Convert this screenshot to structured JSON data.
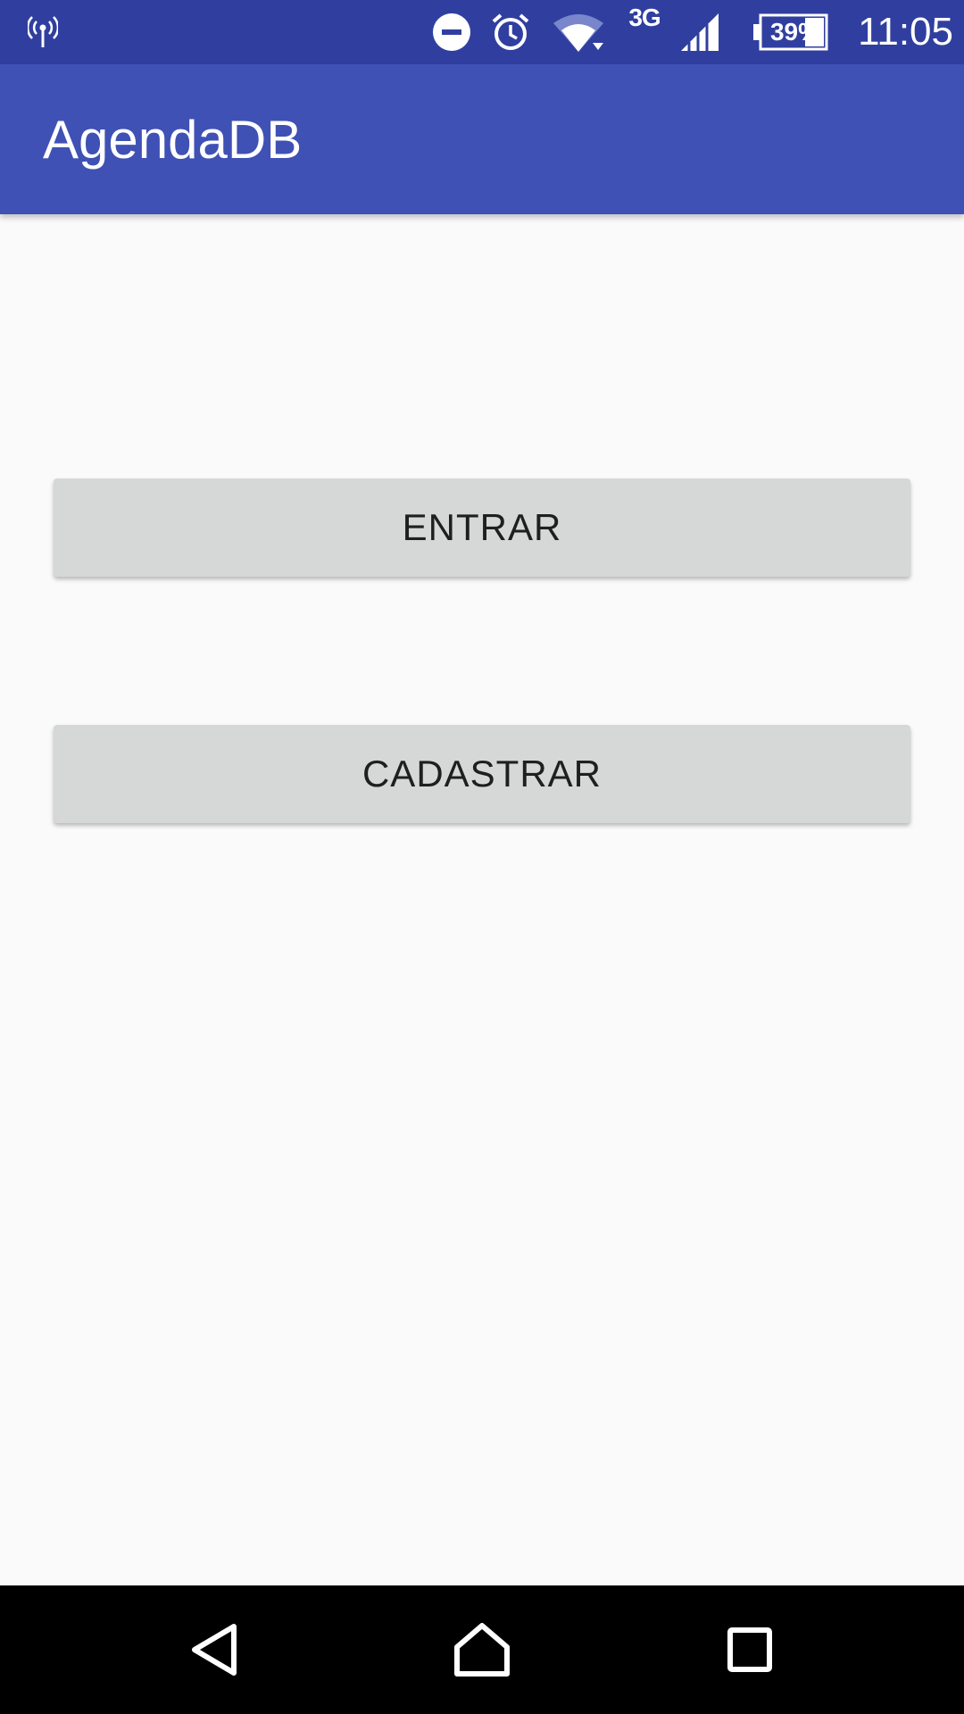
{
  "status_bar": {
    "network_type": "3G",
    "battery_percent": "39%",
    "time": "11:05",
    "icons": [
      "antenna-icon",
      "do-not-disturb-icon",
      "alarm-icon",
      "wifi-icon",
      "cellular-signal-icon",
      "battery-icon"
    ]
  },
  "app_bar": {
    "title": "AgendaDB",
    "color": "#3f51b5",
    "status_color": "#303f9f"
  },
  "main": {
    "buttons": [
      {
        "label": "ENTRAR"
      },
      {
        "label": "CADASTRAR"
      }
    ]
  },
  "nav_bar": {
    "icons": [
      "back-icon",
      "home-icon",
      "recents-icon"
    ]
  }
}
